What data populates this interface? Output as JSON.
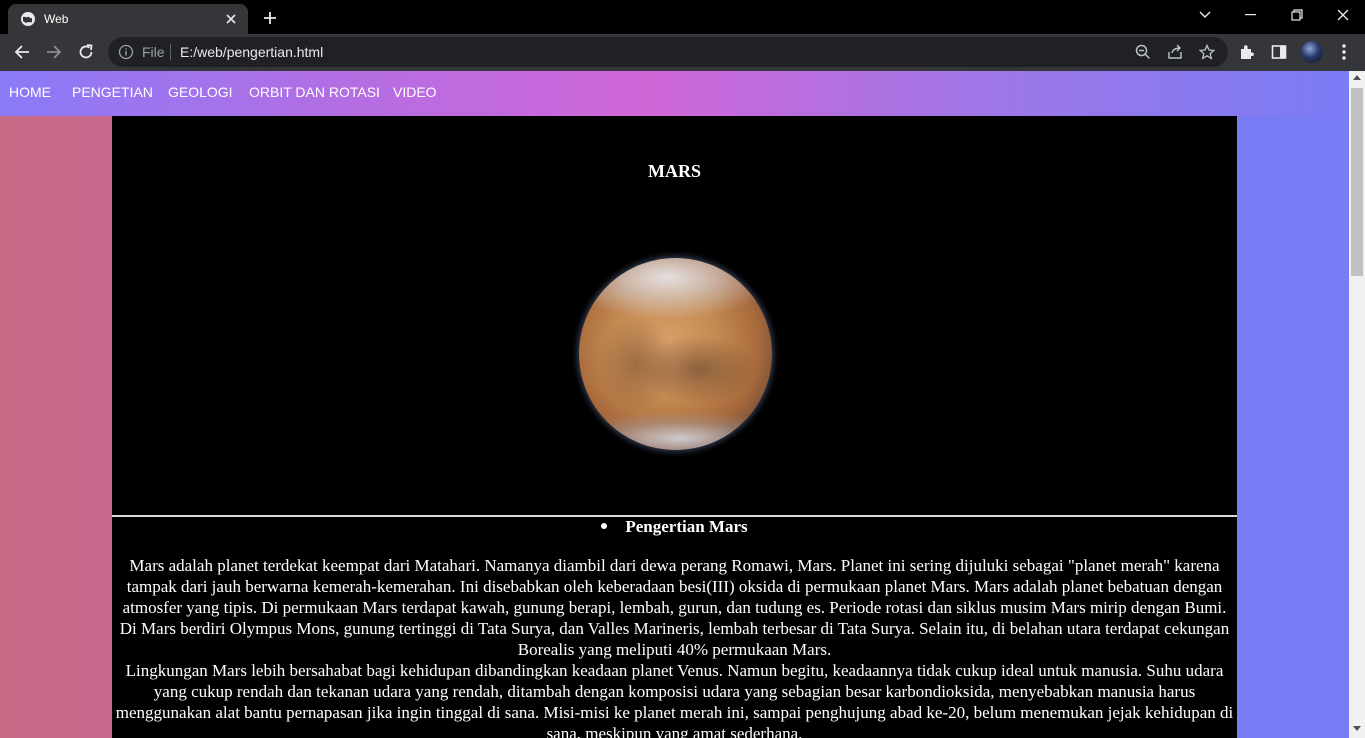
{
  "browser": {
    "tab_title": "Web",
    "omnibox_scheme": "File",
    "omnibox_url": "E:/web/pengertian.html",
    "icons": [
      "globe-icon",
      "close-icon",
      "plus-icon",
      "chevron-down-icon",
      "minimize-icon",
      "restore-icon",
      "close-window-icon",
      "back-icon",
      "forward-icon",
      "reload-icon",
      "info-icon",
      "zoom-icon",
      "share-icon",
      "star-icon",
      "extensions-icon",
      "side-panel-icon",
      "avatar",
      "menu-icon"
    ]
  },
  "nav": {
    "items": [
      {
        "label": "HOME"
      },
      {
        "label": "PENGETIAN"
      },
      {
        "label": "GEOLOGI"
      },
      {
        "label": "ORBIT DAN ROTASI"
      },
      {
        "label": "VIDEO"
      }
    ]
  },
  "main": {
    "title": "MARS",
    "section_heading": "Pengertian Mars",
    "paragraph1": "Mars adalah planet terdekat keempat dari Matahari. Namanya diambil dari dewa perang Romawi, Mars. Planet ini sering dijuluki sebagai \"planet merah\" karena tampak dari jauh berwarna kemerah-kemerahan. Ini disebabkan oleh keberadaan besi(III) oksida di permukaan planet Mars. Mars adalah planet bebatuan dengan atmosfer yang tipis. Di permukaan Mars terdapat kawah, gunung berapi, lembah, gurun, dan tudung es. Periode rotasi dan siklus musim Mars mirip dengan Bumi. Di Mars berdiri Olympus Mons, gunung tertinggi di Tata Surya, dan Valles Marineris, lembah terbesar di Tata Surya. Selain itu, di belahan utara terdapat cekungan Borealis yang meliputi 40% permukaan Mars.",
    "paragraph2": "Lingkungan Mars lebih bersahabat bagi kehidupan dibandingkan keadaan planet Venus. Namun begitu, keadaannya tidak cukup ideal untuk manusia. Suhu udara yang cukup rendah dan tekanan udara yang rendah, ditambah dengan komposisi udara yang sebagian besar karbondioksida, menyebabkan manusia harus menggunakan alat bantu pernapasan jika ingin tinggal di sana. Misi-misi ke planet merah ini, sampai penghujung abad ke-20, belum menemukan jejak kehidupan di sana, meskipun yang amat sederhana."
  }
}
